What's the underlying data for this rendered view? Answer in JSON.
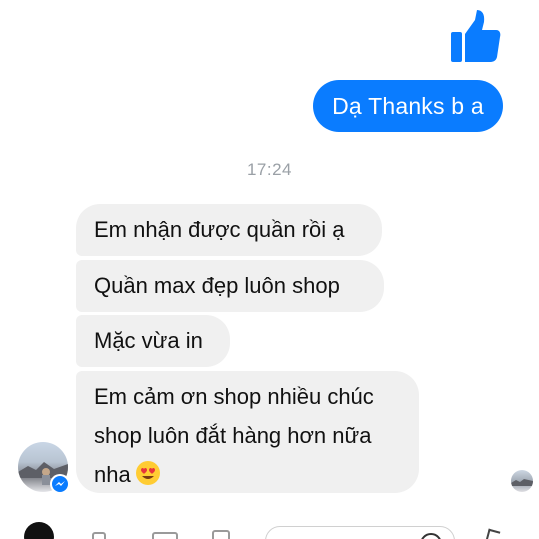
{
  "conversation": {
    "outgoing": [
      {
        "text": "Dạ Thanks b a"
      }
    ],
    "timestamp": "17:24",
    "incoming": [
      {
        "text": "Em nhận được quần rồi ạ"
      },
      {
        "text": "Quần max đẹp luôn shop"
      },
      {
        "text": "Mặc vừa in"
      },
      {
        "lines": [
          "Em cảm ơn shop nhiều chúc",
          "shop luôn đắt hàng hơn nữa",
          "nha"
        ],
        "emoji": "smiling-face-with-heart-eyes"
      }
    ]
  },
  "icons": {
    "like": "thumbs-up-icon",
    "messenger_badge": "messenger-icon",
    "composer": [
      "camera-icon",
      "image-icon",
      "gif-icon",
      "mic-icon",
      "emoji-icon",
      "send-icon"
    ]
  },
  "colors": {
    "accent": "#0a7cff",
    "incoming_bubble": "#f0f0f0",
    "timestamp": "#9aa0a6"
  }
}
